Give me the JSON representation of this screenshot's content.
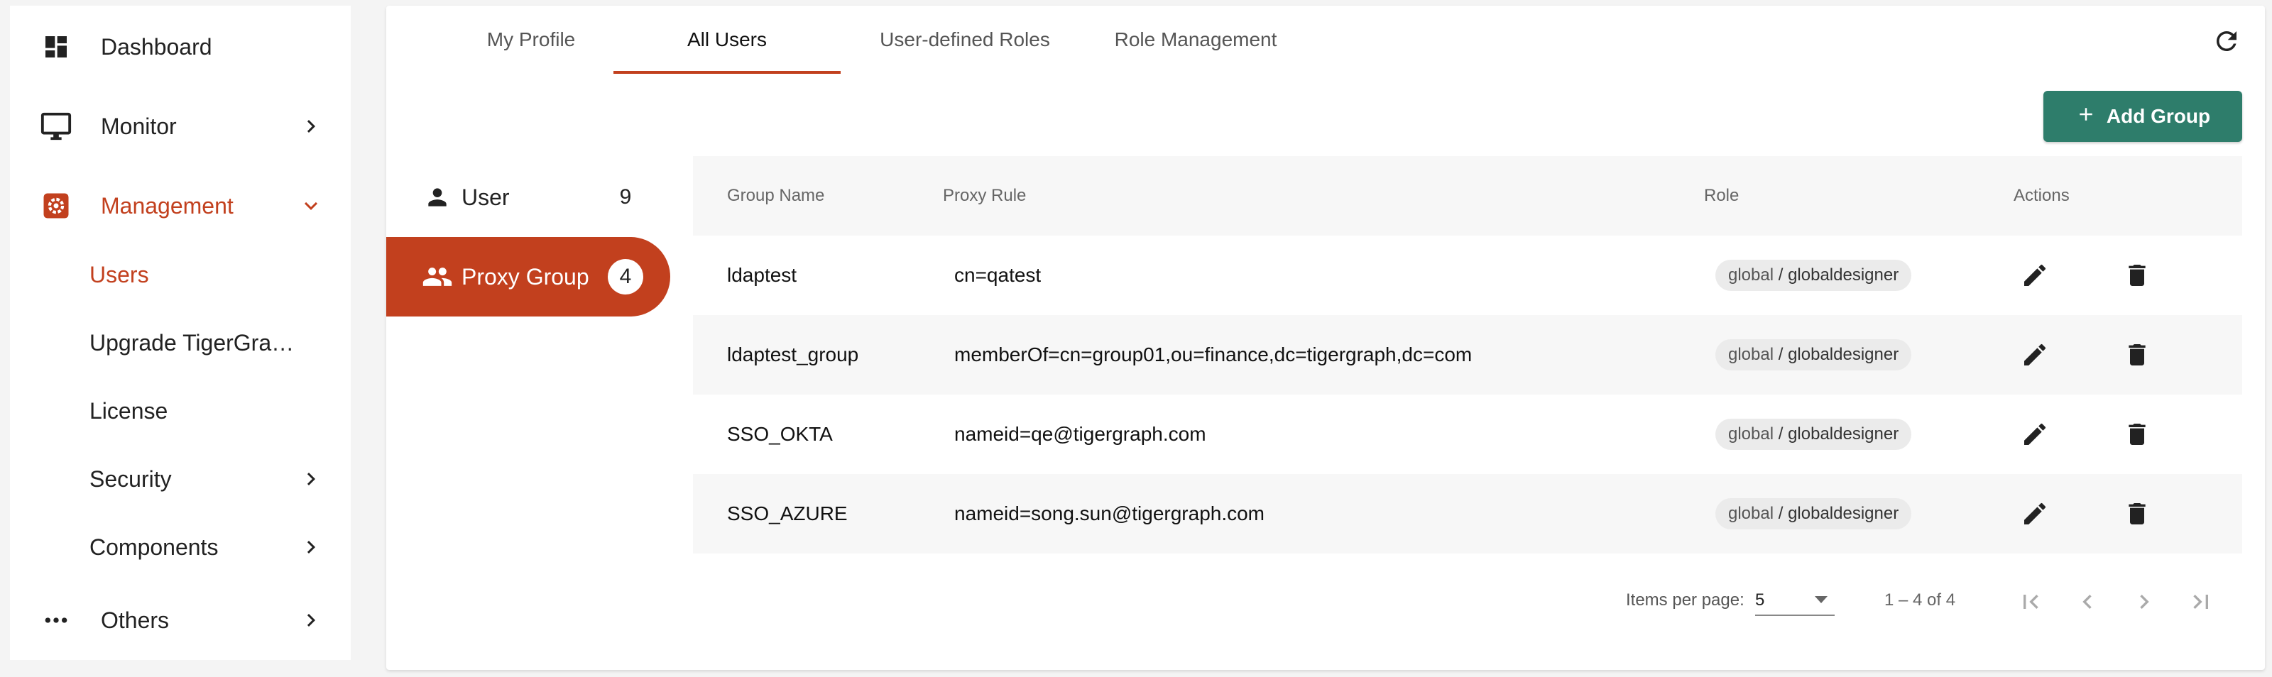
{
  "sidebar": {
    "items": [
      {
        "label": "Dashboard",
        "icon": "dashboard-icon"
      },
      {
        "label": "Monitor",
        "icon": "monitor-icon"
      },
      {
        "label": "Management",
        "icon": "management-icon",
        "expanded": true
      },
      {
        "label": "Others",
        "icon": "more-horiz-icon"
      }
    ],
    "management_children": [
      {
        "label": "Users",
        "active": true
      },
      {
        "label": "Upgrade TigerGraph ..."
      },
      {
        "label": "License"
      },
      {
        "label": "Security"
      },
      {
        "label": "Components"
      }
    ]
  },
  "tabs": [
    {
      "label": "My Profile"
    },
    {
      "label": "All Users",
      "active": true
    },
    {
      "label": "User-defined Roles"
    },
    {
      "label": "Role Management"
    }
  ],
  "toolbar": {
    "add_group_label": "Add Group"
  },
  "left_list": [
    {
      "label": "User",
      "count": "9"
    },
    {
      "label": "Proxy Group",
      "count": "4",
      "active": true
    }
  ],
  "table": {
    "columns": [
      "Group Name",
      "Proxy Rule",
      "Role",
      "Actions"
    ],
    "rows": [
      {
        "group": "ldaptest",
        "rule": "cn=qatest",
        "scope": "global",
        "sep": " / ",
        "role": "globaldesigner"
      },
      {
        "group": "ldaptest_group",
        "rule": "memberOf=cn=group01,ou=finance,dc=tigergraph,dc=com",
        "scope": "global",
        "sep": " / ",
        "role": "globaldesigner"
      },
      {
        "group": "SSO_OKTA",
        "rule": "nameid=qe@tigergraph.com",
        "scope": "global",
        "sep": " / ",
        "role": "globaldesigner"
      },
      {
        "group": "SSO_AZURE",
        "rule": "nameid=song.sun@tigergraph.com",
        "scope": "global",
        "sep": " / ",
        "role": "globaldesigner"
      }
    ]
  },
  "paginator": {
    "items_per_page_label": "Items per page:",
    "page_size": "5",
    "range": "1 – 4 of 4"
  },
  "colors": {
    "accent": "#c2401e",
    "primary_button": "#2e7d6b"
  }
}
